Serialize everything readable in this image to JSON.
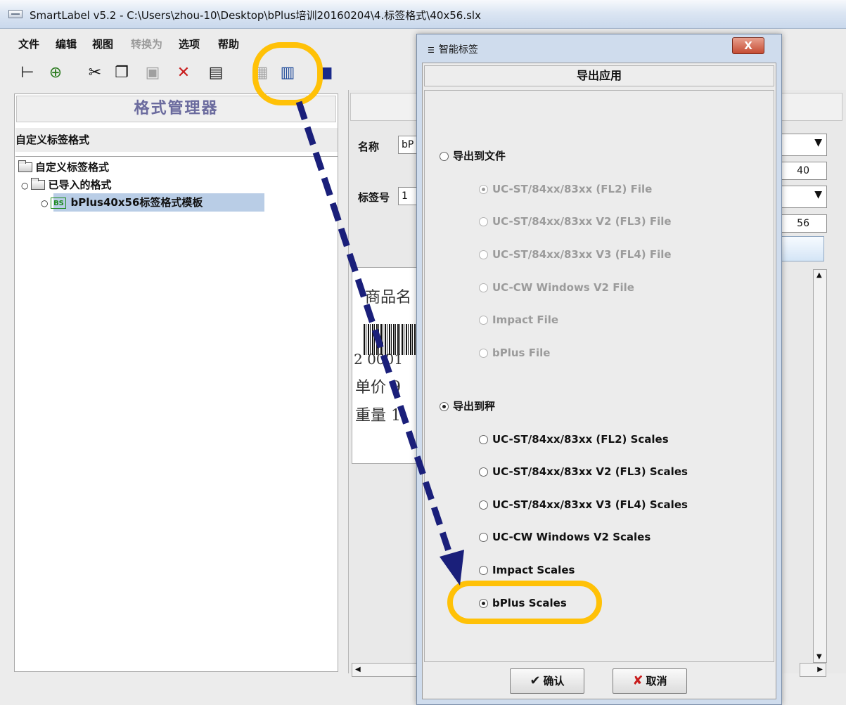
{
  "window": {
    "title": "SmartLabel v5.2 - C:\\Users\\zhou-10\\Desktop\\bPlus培训20160204\\4.标签格式\\40x56.slx"
  },
  "menu": [
    "文件",
    "编辑",
    "视图",
    "转换为",
    "选项",
    "帮助"
  ],
  "left_panel": {
    "header": "格式管理器",
    "section_label": "自定义标签格式",
    "tree": {
      "root": "自定义标签格式",
      "child": "已导入的格式",
      "leaf_badge": "BS",
      "leaf": "bPlus40x56标签格式模板"
    }
  },
  "right_panel": {
    "name_label": "名称",
    "name_value": "bP",
    "label_no_label": "标签号",
    "label_no_value": "1",
    "spinner1": "40",
    "spinner2": "56",
    "preview": {
      "line1": "商品名",
      "barcode_digits": "2 0001",
      "line2": "单价 9",
      "line3": "重量 1"
    }
  },
  "dialog": {
    "title": "智能标签",
    "heading": "导出应用",
    "group_file": "导出到文件",
    "file_options": [
      "UC-ST/84xx/83xx (FL2) File",
      "UC-ST/84xx/83xx V2 (FL3) File",
      "UC-ST/84xx/83xx V3 (FL4) File",
      "UC-CW Windows V2 File",
      "Impact File",
      "bPlus File"
    ],
    "group_scale": "导出到秤",
    "scale_options": [
      "UC-ST/84xx/83xx (FL2) Scales",
      "UC-ST/84xx/83xx V2 (FL3) Scales",
      "UC-ST/84xx/83xx V3 (FL4) Scales",
      "UC-CW Windows V2 Scales",
      "Impact Scales",
      "bPlus Scales"
    ],
    "ok": "确认",
    "cancel": "取消",
    "close": "X"
  },
  "colors": {
    "highlight": "#ffc107",
    "arrow": "#1a1f7a"
  }
}
